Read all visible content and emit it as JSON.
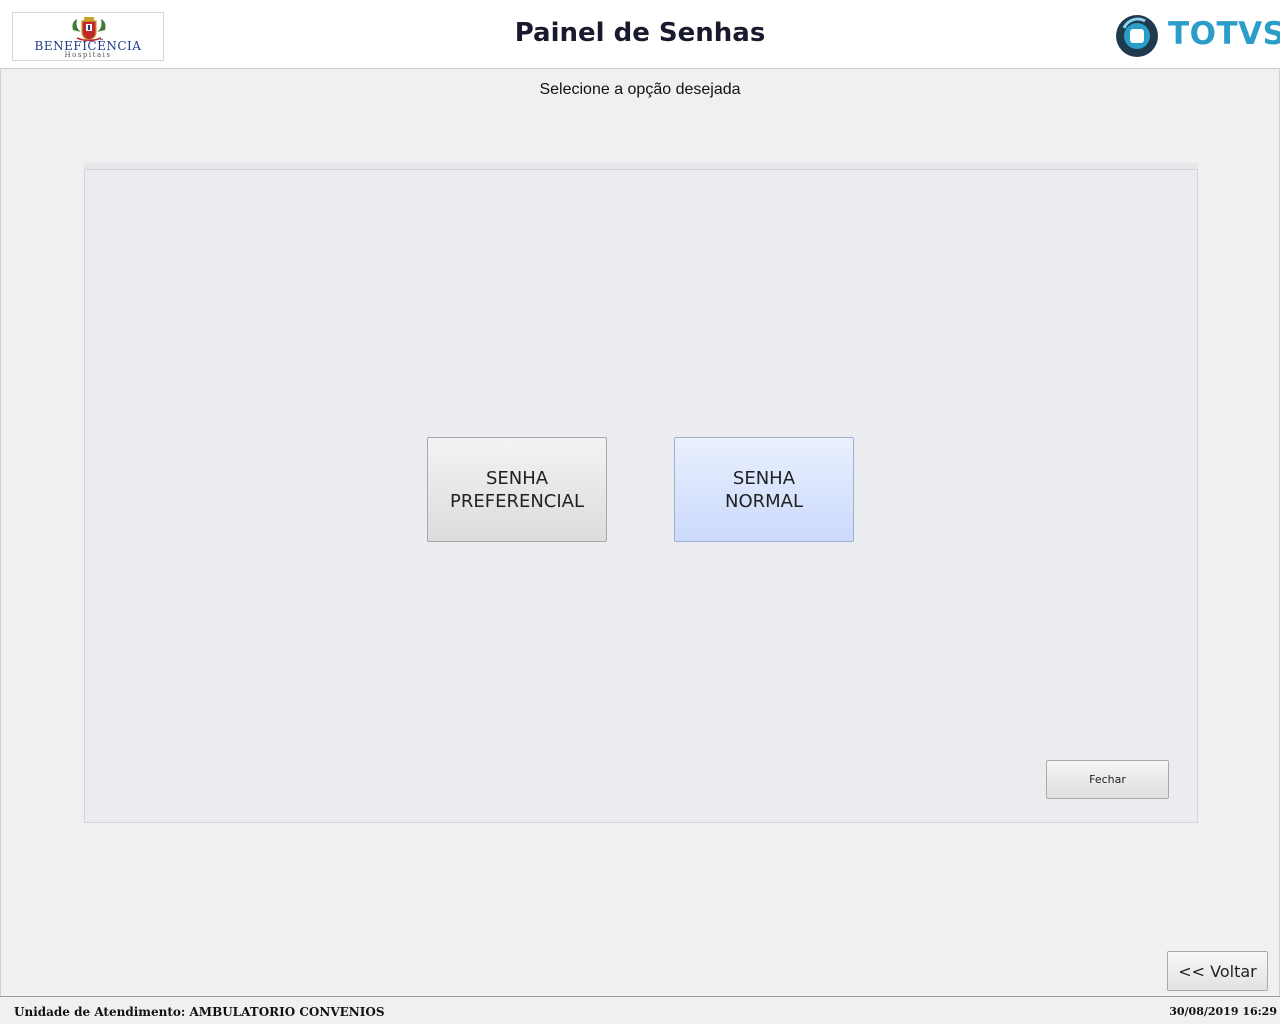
{
  "header": {
    "logo_left": {
      "name": "BENEFICÊNCIA",
      "sub": "Hospitais"
    },
    "title": "Painel de Senhas",
    "logo_right": {
      "name": "TOTVS",
      "color": "#2a9ec9"
    }
  },
  "main": {
    "subtitle": "Selecione a opção desejada",
    "buttons": {
      "preferencial": {
        "line1": "SENHA",
        "line2": "PREFERENCIAL"
      },
      "normal": {
        "line1": "SENHA",
        "line2": "NORMAL"
      },
      "close": "Fechar",
      "back": "<< Voltar"
    }
  },
  "status": {
    "unit": "Unidade de Atendimento: AMBULATORIO CONVENIOS",
    "datetime": "30/08/2019 16:29"
  },
  "icons": [
    "hospital-crest-icon",
    "totvs-logo-icon"
  ],
  "colors": {
    "accent": "#2a9ec9",
    "selected_button": "#cbd9fb",
    "panel_bg": "#ebecef"
  }
}
